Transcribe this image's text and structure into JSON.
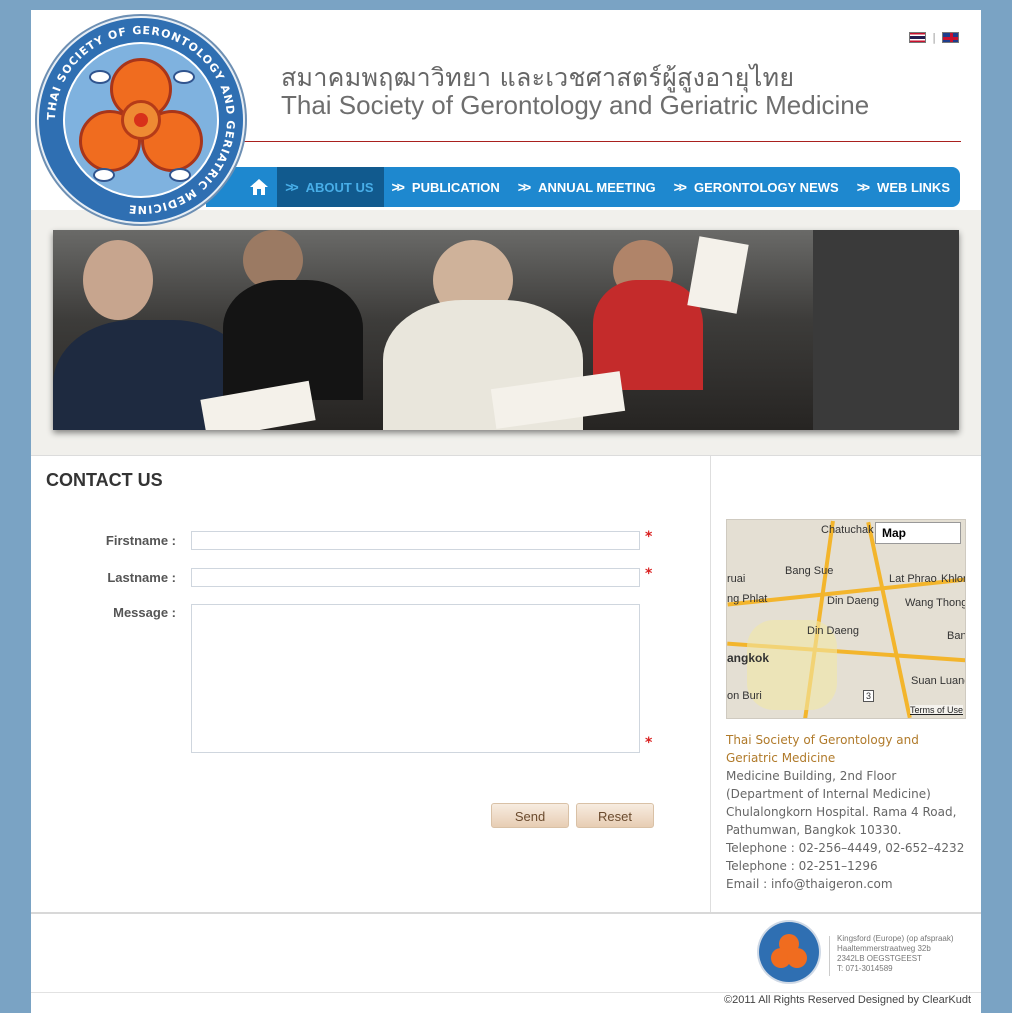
{
  "header": {
    "title_thai": "สมาคมพฤฒาวิทยา และเวชศาสตร์ผู้สูงอายุไทย",
    "title_english": "Thai Society of Gerontology and Geriatric Medicine",
    "language_separator": "|",
    "logo_text": "THAI SOCIETY OF GERONTOLOGY AND GERIATRIC MEDICINE"
  },
  "nav": {
    "items": [
      {
        "label": "ABOUT US",
        "active": true
      },
      {
        "label": "PUBLICATION",
        "active": false
      },
      {
        "label": "ANNUAL MEETING",
        "active": false
      },
      {
        "label": "GERONTOLOGY NEWS",
        "active": false
      },
      {
        "label": "WEB LINKS",
        "active": false
      }
    ]
  },
  "contact": {
    "title": "CONTACT US",
    "firstname_label": "Firstname :",
    "lastname_label": "Lastname :",
    "message_label": "Message :",
    "required_mark": "*",
    "send_label": "Send",
    "reset_label": "Reset"
  },
  "map": {
    "title": "Map",
    "terms": "Terms of Use",
    "labels": [
      "Chatuchak",
      "Bang Sue",
      "Lat Phrao",
      "Khlon",
      "ruai",
      "ng Phlat",
      "Din Daeng",
      "Wang Thong Lang",
      "Din Daeng",
      "Ban",
      "angkok",
      "Suan Luang",
      "on Buri",
      "3"
    ]
  },
  "address": {
    "org": "Thai Society of Gerontology and Geriatric Medicine",
    "line1": "Medicine Building, 2nd Floor (Department of Internal Medicine) Chulalongkorn Hospital. Rama 4 Road, Pathumwan, Bangkok 10330.",
    "phone1": "Telephone : 02-256–4449, 02-652–4232",
    "phone2": "Telephone : 02-251–1296",
    "email": "Email : info@thaigeron.com"
  },
  "footer": {
    "address_lines": [
      "Kingsford (Europe) (op afspraak)",
      "Haaltemmerstraatweg 32b",
      "2342LB OEGSTGEEST",
      "T: 071-3014589"
    ],
    "copyright": "©2011 All Rights Reserved Designed by ClearKudt"
  },
  "colors": {
    "background": "#7aa3c4",
    "nav": "#1e88cf",
    "nav_active": "#115a8e",
    "accent_rule": "#a9201e",
    "required": "#d91f1f"
  },
  "icons": [
    "home-icon",
    "chevron-double-right-icon",
    "flag-thai-icon",
    "flag-uk-icon"
  ]
}
